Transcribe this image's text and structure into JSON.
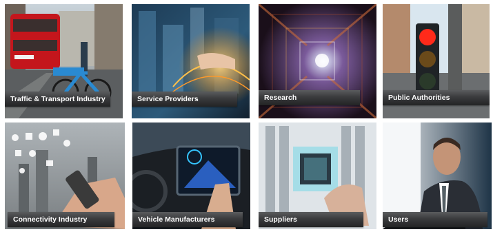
{
  "tiles": [
    {
      "label": "Traffic & Transport Industry",
      "image": "city-street-double-decker-bus-bike-rental"
    },
    {
      "label": "Service Providers",
      "image": "hand-touching-glowing-data-city"
    },
    {
      "label": "Research",
      "image": "glowing-circuit-tunnel"
    },
    {
      "label": "Public Authorities",
      "image": "traffic-light-red"
    },
    {
      "label": "Connectivity Industry",
      "image": "hand-holding-phone-with-app-icons-cityscape"
    },
    {
      "label": "Vehicle Manufacturers",
      "image": "car-dashboard-navigation-touchscreen"
    },
    {
      "label": "Suppliers",
      "image": "hand-holding-microchip-server-rack"
    },
    {
      "label": "Users",
      "image": "man-in-suit-driving-car"
    }
  ],
  "colors": {
    "caption_top": "#5a5c5e",
    "caption_bottom": "#232425",
    "caption_text": "#ffffff",
    "page_background": "#ffffff"
  }
}
